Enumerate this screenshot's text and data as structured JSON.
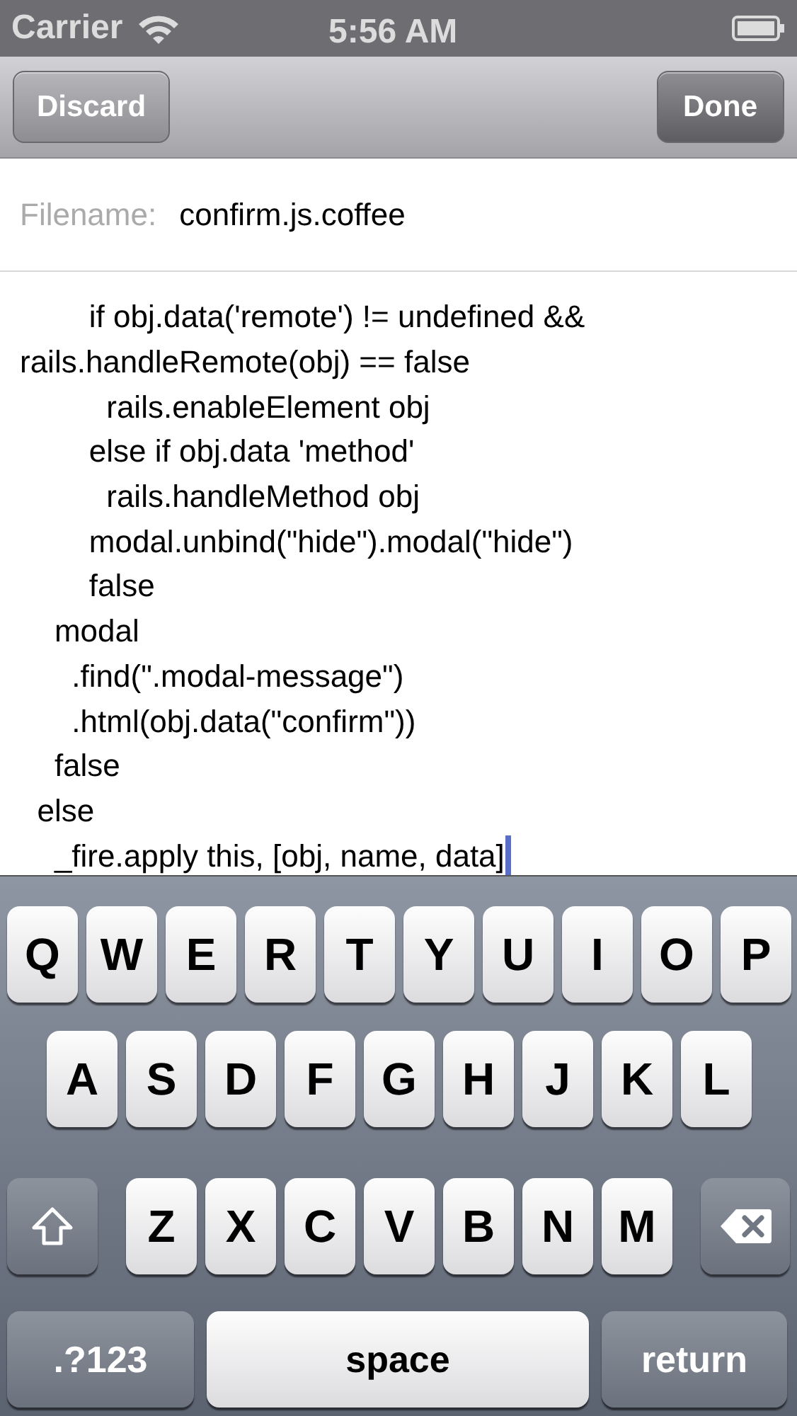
{
  "status_bar": {
    "carrier": "Carrier",
    "time": "5:56 AM"
  },
  "nav_bar": {
    "buttons": [
      {
        "label": "Discard",
        "kind": "discard"
      },
      {
        "label": "Done",
        "kind": "done"
      }
    ]
  },
  "filename": {
    "label": "Filename:",
    "value": "confirm.js.coffee"
  },
  "editor": {
    "lines": [
      {
        "text": "        if obj.data('remote') != undefined &&",
        "cursor": false
      },
      {
        "text": "rails.handleRemote(obj) == false",
        "cursor": false
      },
      {
        "text": "          rails.enableElement obj",
        "cursor": false
      },
      {
        "text": "        else if obj.data 'method'",
        "cursor": false
      },
      {
        "text": "          rails.handleMethod obj",
        "cursor": false
      },
      {
        "text": "        modal.unbind(\"hide\").modal(\"hide\")",
        "cursor": false
      },
      {
        "text": "        false",
        "cursor": false
      },
      {
        "text": "    modal",
        "cursor": false
      },
      {
        "text": "      .find(\".modal-message\")",
        "cursor": false
      },
      {
        "text": "      .html(obj.data(\"confirm\"))",
        "cursor": false
      },
      {
        "text": "    false",
        "cursor": false
      },
      {
        "text": "  else",
        "cursor": false
      },
      {
        "text": "    _fire.apply this, [obj, name, data]",
        "cursor": true
      }
    ]
  },
  "keyboard": {
    "rows": [
      {
        "keys": [
          {
            "kind": "letter",
            "label": "Q"
          },
          {
            "kind": "letter",
            "label": "W"
          },
          {
            "kind": "letter",
            "label": "E"
          },
          {
            "kind": "letter",
            "label": "R"
          },
          {
            "kind": "letter",
            "label": "T"
          },
          {
            "kind": "letter",
            "label": "Y"
          },
          {
            "kind": "letter",
            "label": "U"
          },
          {
            "kind": "letter",
            "label": "I"
          },
          {
            "kind": "letter",
            "label": "O"
          },
          {
            "kind": "letter",
            "label": "P"
          }
        ]
      },
      {
        "keys": [
          {
            "kind": "letter",
            "label": "A"
          },
          {
            "kind": "letter",
            "label": "S"
          },
          {
            "kind": "letter",
            "label": "D"
          },
          {
            "kind": "letter",
            "label": "F"
          },
          {
            "kind": "letter",
            "label": "G"
          },
          {
            "kind": "letter",
            "label": "H"
          },
          {
            "kind": "letter",
            "label": "J"
          },
          {
            "kind": "letter",
            "label": "K"
          },
          {
            "kind": "letter",
            "label": "L"
          }
        ]
      },
      {
        "keys": [
          {
            "kind": "shift"
          },
          {
            "kind": "letter",
            "label": "Z"
          },
          {
            "kind": "letter",
            "label": "X"
          },
          {
            "kind": "letter",
            "label": "C"
          },
          {
            "kind": "letter",
            "label": "V"
          },
          {
            "kind": "letter",
            "label": "B"
          },
          {
            "kind": "letter",
            "label": "N"
          },
          {
            "kind": "letter",
            "label": "M"
          },
          {
            "kind": "delete"
          }
        ]
      },
      {
        "keys": [
          {
            "kind": "mode",
            "label": ".?123"
          },
          {
            "kind": "space",
            "label": "space"
          },
          {
            "kind": "return",
            "label": "return"
          }
        ]
      }
    ]
  }
}
